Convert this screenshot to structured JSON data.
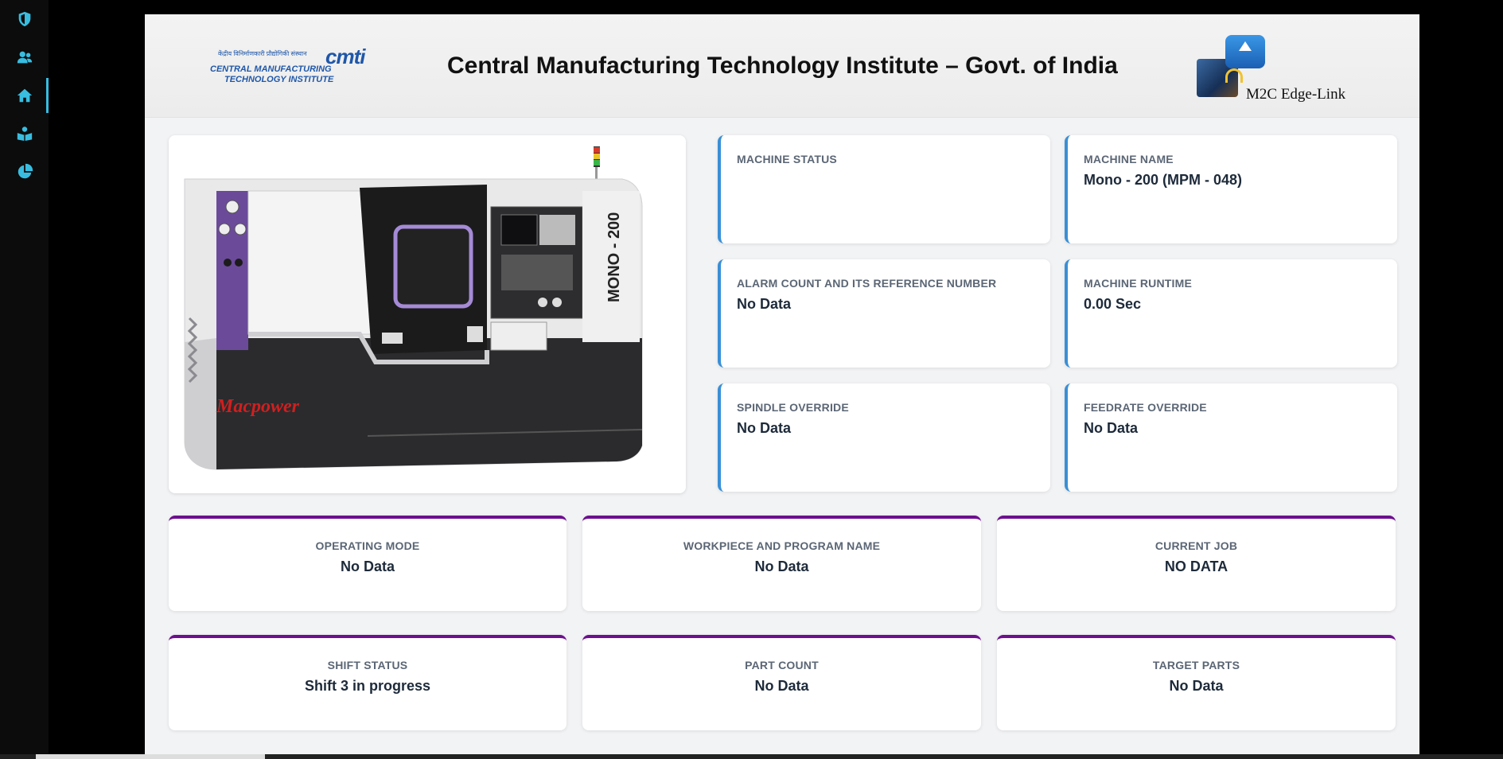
{
  "sidebar": {
    "items": [
      {
        "icon": "shield-icon",
        "active": false
      },
      {
        "icon": "users-icon",
        "active": false
      },
      {
        "icon": "home-icon",
        "active": true
      },
      {
        "icon": "book-reader-icon",
        "active": false
      },
      {
        "icon": "pie-chart-icon",
        "active": false
      }
    ],
    "accent_color": "#38bde0"
  },
  "header": {
    "title": "Central Manufacturing Technology Institute – Govt. of India",
    "cmti_logo": {
      "hindi": "केंद्रीय विनिर्माणकारी प्रौद्योगिकी संस्थान",
      "mark": "cmti",
      "line1": "CENTRAL MANUFACTURING",
      "line2": "TECHNOLOGY INSTITUTE"
    },
    "m2c_logo": {
      "name": "M2C Edge-Link"
    }
  },
  "machine_image": {
    "model_label": "MONO - 200",
    "brand": "Macpower"
  },
  "info_cards": [
    {
      "label": "MACHINE STATUS",
      "value": ""
    },
    {
      "label": "MACHINE NAME",
      "value": "Mono - 200 (MPM - 048)"
    },
    {
      "label": "ALARM COUNT AND ITS REFERENCE NUMBER",
      "value": "No Data"
    },
    {
      "label": "MACHINE RUNTIME",
      "value": "0.00 Sec"
    },
    {
      "label": "SPINDLE OVERRIDE",
      "value": "No Data"
    },
    {
      "label": "FEEDRATE OVERRIDE",
      "value": "No Data"
    }
  ],
  "status_cards": [
    {
      "label": "OPERATING MODE",
      "value": "No Data"
    },
    {
      "label": "WORKPIECE AND PROGRAM NAME",
      "value": "No Data"
    },
    {
      "label": "CURRENT JOB",
      "value": "NO DATA"
    },
    {
      "label": "SHIFT STATUS",
      "value": "Shift 3 in progress"
    },
    {
      "label": "PART COUNT",
      "value": "No Data"
    },
    {
      "label": "TARGET PARTS",
      "value": "No Data"
    }
  ],
  "colors": {
    "info_card_border": "#3a8fd6",
    "status_card_border": "#6d0f8f",
    "panel_background": "#f2f3f5"
  }
}
